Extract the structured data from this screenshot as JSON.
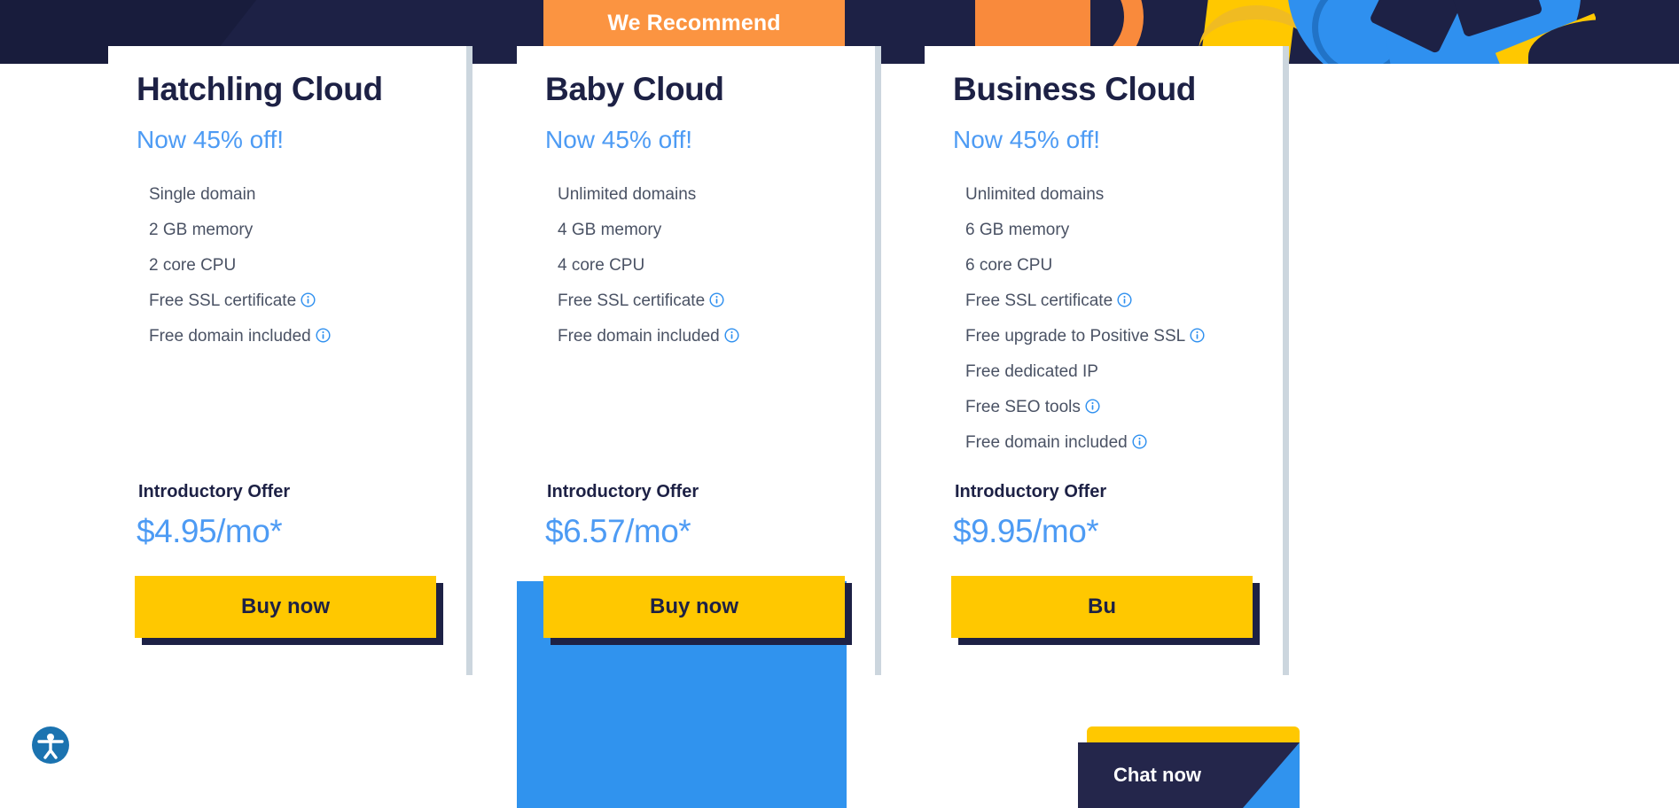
{
  "banner": {
    "label": "We Recommend"
  },
  "plans": [
    {
      "name": "Hatchling Cloud",
      "discount": "Now 45% off!",
      "features": [
        {
          "text": "Single domain",
          "info": false
        },
        {
          "text": "2 GB memory",
          "info": false
        },
        {
          "text": "2 core CPU",
          "info": false
        },
        {
          "text": "Free SSL certificate",
          "info": true
        },
        {
          "text": "Free domain included",
          "info": true
        }
      ],
      "offer_label": "Introductory Offer",
      "price": "$4.95/mo*",
      "cta": "Buy now"
    },
    {
      "name": "Baby Cloud",
      "discount": "Now 45% off!",
      "features": [
        {
          "text": "Unlimited domains",
          "info": false
        },
        {
          "text": "4 GB memory",
          "info": false
        },
        {
          "text": "4 core CPU",
          "info": false
        },
        {
          "text": "Free SSL certificate",
          "info": true
        },
        {
          "text": "Free domain included",
          "info": true
        }
      ],
      "offer_label": "Introductory Offer",
      "price": "$6.57/mo*",
      "cta": "Buy now"
    },
    {
      "name": "Business Cloud",
      "discount": "Now 45% off!",
      "features": [
        {
          "text": "Unlimited domains",
          "info": false
        },
        {
          "text": "6 GB memory",
          "info": false
        },
        {
          "text": "6 core CPU",
          "info": false
        },
        {
          "text": "Free SSL certificate",
          "info": true
        },
        {
          "text": "Free upgrade to Positive SSL",
          "info": true
        },
        {
          "text": "Free dedicated IP",
          "info": false
        },
        {
          "text": "Free SEO tools",
          "info": true
        },
        {
          "text": "Free domain included",
          "info": true
        }
      ],
      "offer_label": "Introductory Offer",
      "price": "$9.95/mo*",
      "cta": "Bu"
    }
  ],
  "chat": {
    "label": "Chat now"
  },
  "accessibility": {
    "icon": "accessibility-icon"
  },
  "colors": {
    "navy": "#1d2145",
    "yellow": "#ffc800",
    "blue": "#4d9bf4",
    "accent_blue": "#3093ee",
    "orange": "#fb9441",
    "divider": "#ccd6de",
    "feature_text": "#4a5264"
  }
}
